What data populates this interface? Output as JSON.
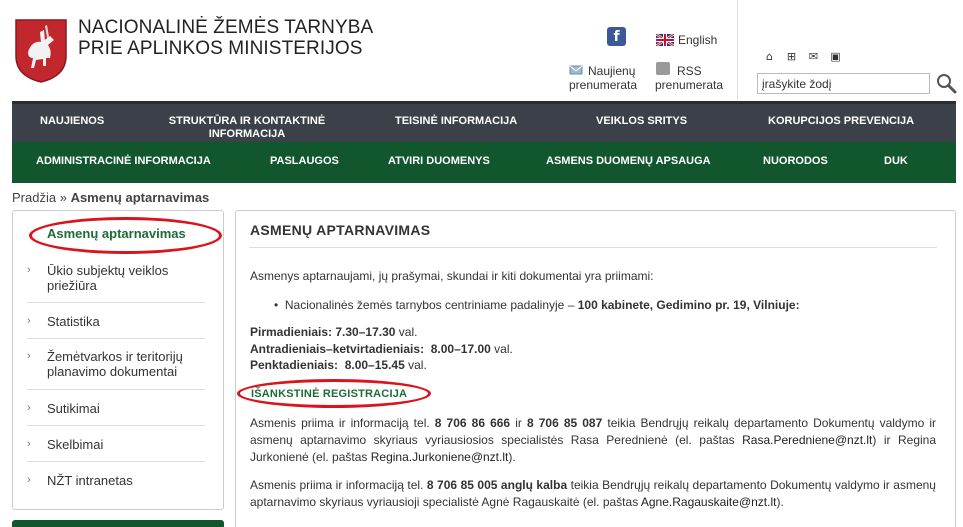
{
  "header": {
    "title_line1": "NACIONALINĖ ŽEMĖS TARNYBA",
    "title_line2": "PRIE APLINKOS MINISTERIJOS",
    "facebook_label": "f",
    "lang_label": "English",
    "news_line1": "Naujienų",
    "news_line2": "prenumerata",
    "rss_line1": "RSS",
    "rss_line2": "prenumerata",
    "search_value": "įrašykite žodį"
  },
  "nav_top": [
    "NAUJIENOS",
    "STRUKTŪRA IR KONTAKTINĖ",
    "INFORMACIJA",
    "TEISINĖ INFORMACIJA",
    "VEIKLOS SRITYS",
    "KORUPCIJOS PREVENCIJA"
  ],
  "nav_bottom": [
    "ADMINISTRACINĖ INFORMACIJA",
    "PASLAUGOS",
    "ATVIRI DUOMENYS",
    "ASMENS DUOMENŲ APSAUGA",
    "NUORODOS",
    "DUK"
  ],
  "breadcrumb": {
    "home": "Pradžia",
    "sep": "»",
    "current": "Asmenų aptarnavimas"
  },
  "sidebar": [
    {
      "label": "Asmenų aptarnavimas"
    },
    {
      "label1": "Ūkio subjektų veiklos",
      "label2": "priežiūra"
    },
    {
      "label": "Statistika"
    },
    {
      "label1": "Žemėtvarkos ir teritorijų",
      "label2": "planavimo dokumentai"
    },
    {
      "label": "Sutikimai"
    },
    {
      "label": "Skelbimai"
    },
    {
      "label": "NŽT intranetas"
    }
  ],
  "main": {
    "heading": "ASMENŲ APTARNAVIMAS",
    "intro": "Asmenys aptarnaujami, jų prašymai, skundai ir kiti dokumentai yra priimami:",
    "bullet_text": "Nacionalinės žemės tarnybos centriniame padalinyje –",
    "bullet_bold": "100 kabinete, Gedimino pr. 19, Vilniuje:",
    "hours": [
      {
        "day": "Pirmadieniais:",
        "time": "7.30–17.30",
        "unit": "val."
      },
      {
        "day": "Antradieniais–ketvirtadieniais:",
        "time": "8.00–17.00",
        "unit": "val."
      },
      {
        "day": "Penktadieniais:",
        "time": "8.00–15.45",
        "unit": "val."
      }
    ],
    "reg_heading": "IŠANKSTINĖ REGISTRACIJA",
    "para1": {
      "a": "Asmenis priima ir informaciją tel.",
      "tel1": "8 706 86 666",
      "b": "ir",
      "tel2": "8 706 85 087",
      "c": "teikia Bendrųjų reikalų departamento Dokumentų valdymo ir asmenų aptarnavimo skyriaus vyriausiosios specialistės Rasa Perednienė (el. paštas",
      "email1": "Rasa.Peredniene@nzt.lt",
      "d": ") ir Regina Jurkonienė (el. paštas",
      "email2": "Regina.Jurkoniene@nzt.lt",
      "e": ")."
    },
    "para2": {
      "a": "Asmenis priima ir informaciją tel.",
      "tel": "8 706 85 005 anglų kalba",
      "b": "teikia Bendrųjų reikalų departamento Dokumentų valdymo ir asmenų aptarnavimo skyriaus vyriausioji specialistė Agnė Ragauskaitė (el. paštas",
      "email": "Agne.Ragauskaite@nzt.lt",
      "c": ")."
    }
  },
  "colors": {
    "nav_top": "#3c4149",
    "nav_bottom": "#11562d",
    "accent_green": "#1d6b3a",
    "annotation_red": "#d9141c"
  }
}
